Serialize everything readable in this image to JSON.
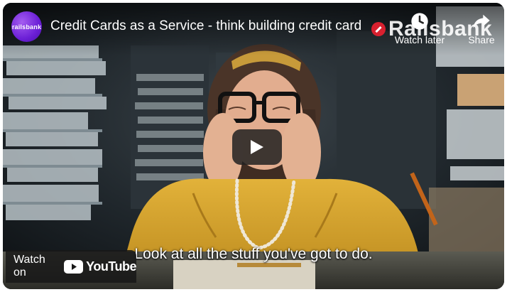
{
  "player": {
    "title": "Credit Cards as a Service - think building credit card",
    "channel_avatar_text": "railsbank",
    "watermark_text": "Railsbank",
    "watch_later_label": "Watch later",
    "share_label": "Share",
    "caption": "Look at all the stuff you've got to do.",
    "watch_on_label": "Watch on",
    "youtube_label": "YouTube",
    "icons": [
      "clock-icon",
      "share-arrow-icon",
      "play-icon",
      "youtube-logo-icon",
      "railsbank-brand-icon"
    ],
    "colors": {
      "avatar": "#7b2ee8",
      "brand_mark": "#d8202f",
      "youtube_red": "#ff0000",
      "sweater": "#d9a82f"
    }
  }
}
